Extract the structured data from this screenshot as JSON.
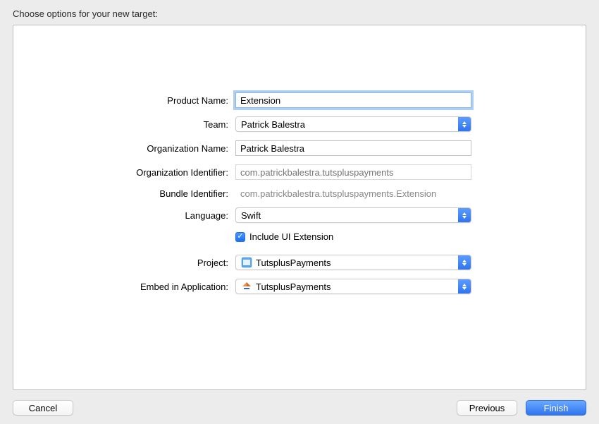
{
  "header": "Choose options for your new target:",
  "form": {
    "productName": {
      "label": "Product Name:",
      "value": "Extension"
    },
    "team": {
      "label": "Team:",
      "value": "Patrick Balestra"
    },
    "orgName": {
      "label": "Organization Name:",
      "value": "Patrick Balestra"
    },
    "orgIdentifier": {
      "label": "Organization Identifier:",
      "placeholder": "com.patrickbalestra.tutspluspayments"
    },
    "bundleIdentifier": {
      "label": "Bundle Identifier:",
      "value": "com.patrickbalestra.tutspluspayments.Extension"
    },
    "language": {
      "label": "Language:",
      "value": "Swift"
    },
    "includeUIExtension": {
      "label": "Include UI Extension",
      "checked": true
    },
    "project": {
      "label": "Project:",
      "value": "TutsplusPayments"
    },
    "embed": {
      "label": "Embed in Application:",
      "value": "TutsplusPayments"
    }
  },
  "buttons": {
    "cancel": "Cancel",
    "previous": "Previous",
    "finish": "Finish"
  }
}
